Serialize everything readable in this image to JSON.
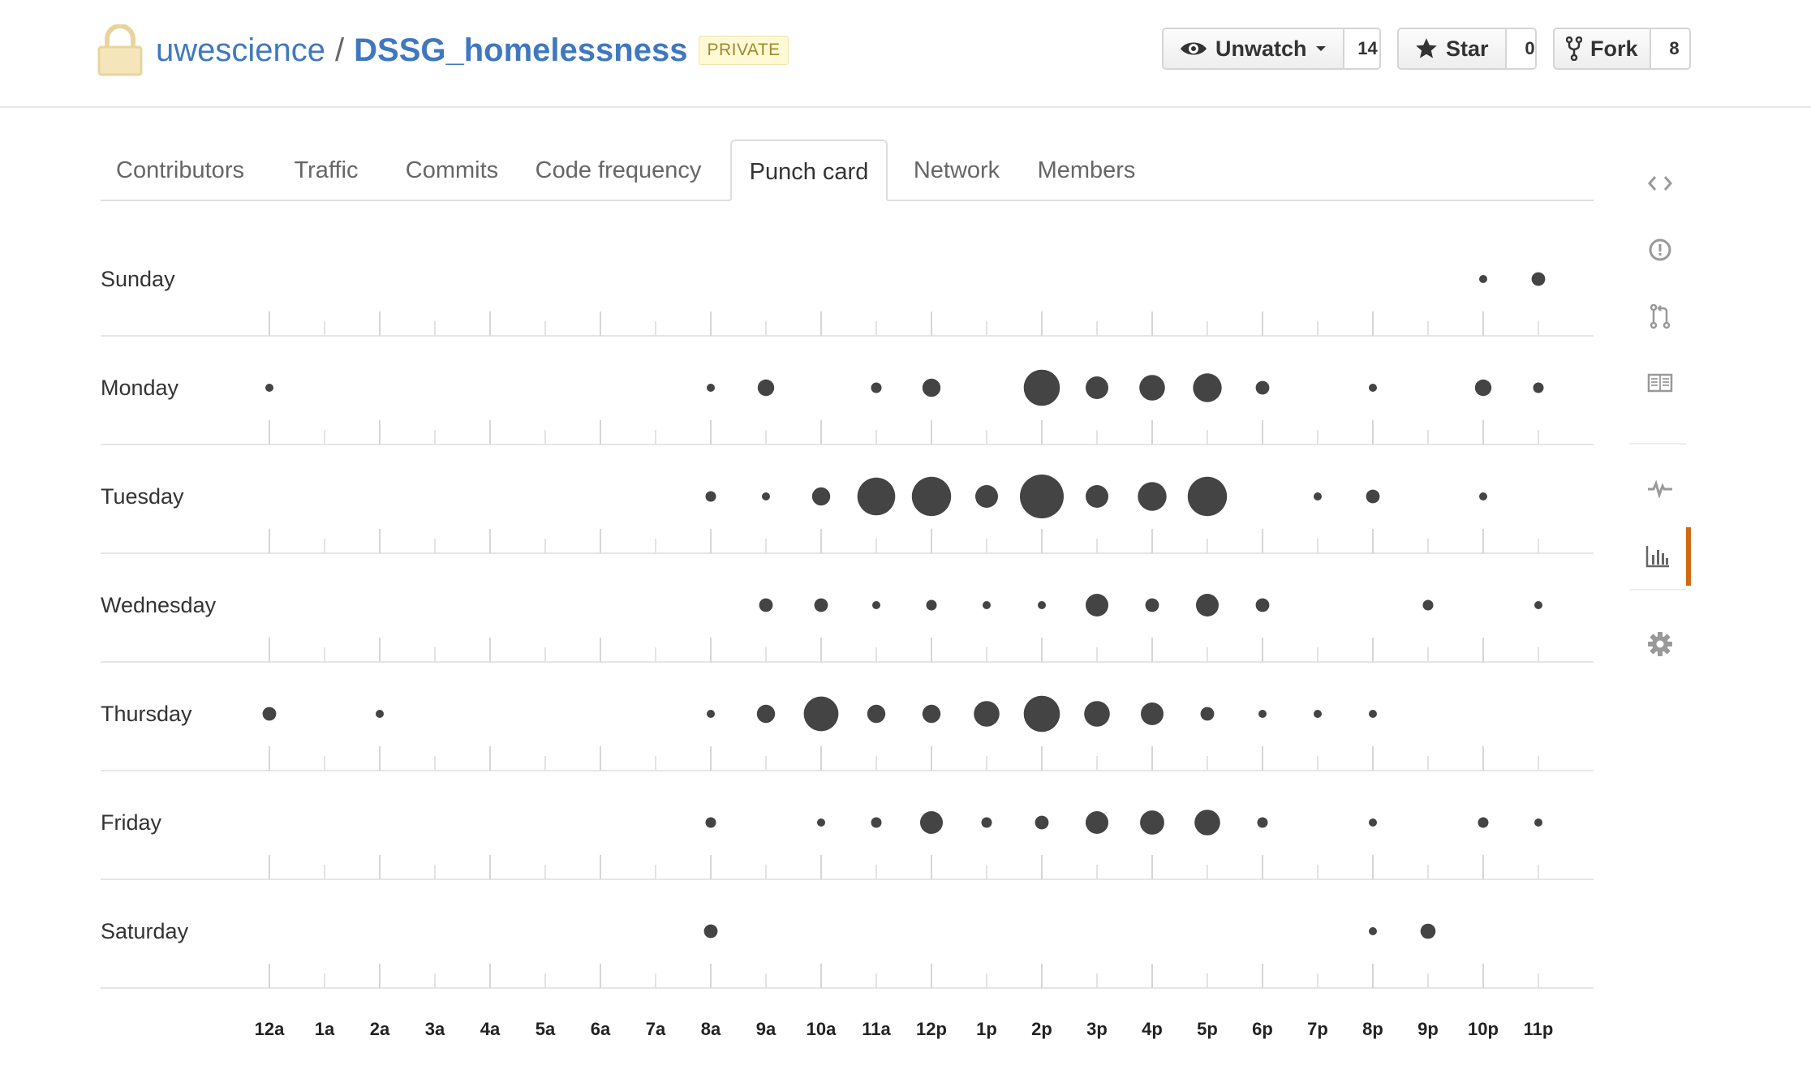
{
  "repo": {
    "owner": "uwescience",
    "separator": "/",
    "name": "DSSG_homelessness",
    "badge": "PRIVATE"
  },
  "actions": {
    "watch": {
      "label": "Unwatch",
      "count": "14"
    },
    "star": {
      "label": "Star",
      "count": "0"
    },
    "fork": {
      "label": "Fork",
      "count": "8"
    }
  },
  "tabs": [
    {
      "label": "Contributors",
      "selected": false
    },
    {
      "label": "Traffic",
      "selected": false
    },
    {
      "label": "Commits",
      "selected": false
    },
    {
      "label": "Code frequency",
      "selected": false
    },
    {
      "label": "Punch card",
      "selected": true
    },
    {
      "label": "Network",
      "selected": false
    },
    {
      "label": "Members",
      "selected": false
    }
  ],
  "sidebar": {
    "items": [
      {
        "icon": "code-icon"
      },
      {
        "icon": "issues-icon"
      },
      {
        "icon": "pull-request-icon"
      },
      {
        "icon": "wiki-icon"
      },
      {
        "icon": "pulse-icon"
      },
      {
        "icon": "graphs-icon",
        "active": true
      },
      {
        "icon": "settings-icon"
      }
    ],
    "accent": "#d26911"
  },
  "colors": {
    "link": "#4078c0",
    "dot": "#444444",
    "rule": "#e5e5e5"
  },
  "chart_data": {
    "type": "scatter",
    "days": [
      "Sunday",
      "Monday",
      "Tuesday",
      "Wednesday",
      "Thursday",
      "Friday",
      "Saturday"
    ],
    "hours": [
      "12a",
      "1a",
      "2a",
      "3a",
      "4a",
      "5a",
      "6a",
      "7a",
      "8a",
      "9a",
      "10a",
      "11a",
      "12p",
      "1p",
      "2p",
      "3p",
      "4p",
      "5p",
      "6p",
      "7p",
      "8p",
      "9p",
      "10p",
      "11p"
    ],
    "max_size": 29,
    "values": [
      [
        0,
        0,
        0,
        0,
        0,
        0,
        0,
        0,
        0,
        0,
        0,
        0,
        0,
        0,
        0,
        0,
        0,
        0,
        0,
        0,
        0,
        0,
        5,
        9
      ],
      [
        5,
        0,
        0,
        0,
        0,
        0,
        0,
        0,
        5,
        11,
        0,
        7,
        12,
        0,
        24,
        15,
        17,
        19,
        9,
        0,
        5,
        0,
        11,
        7
      ],
      [
        0,
        0,
        0,
        0,
        0,
        0,
        0,
        0,
        7,
        5,
        12,
        25,
        26,
        15,
        29,
        15,
        19,
        26,
        0,
        4,
        9,
        0,
        4,
        0
      ],
      [
        0,
        0,
        0,
        0,
        0,
        0,
        0,
        0,
        0,
        9,
        9,
        3,
        7,
        5,
        3,
        15,
        9,
        15,
        9,
        0,
        0,
        7,
        0,
        3
      ],
      [
        9,
        0,
        4,
        0,
        0,
        0,
        0,
        0,
        5,
        12,
        23,
        12,
        12,
        17,
        24,
        17,
        15,
        9,
        5,
        5,
        3,
        0,
        0,
        0
      ],
      [
        0,
        0,
        0,
        0,
        0,
        0,
        0,
        0,
        7,
        0,
        3,
        7,
        15,
        7,
        9,
        15,
        16,
        17,
        7,
        0,
        3,
        0,
        7,
        3
      ],
      [
        0,
        0,
        0,
        0,
        0,
        0,
        0,
        0,
        9,
        0,
        0,
        0,
        0,
        0,
        0,
        0,
        0,
        0,
        0,
        0,
        5,
        10,
        0,
        0
      ]
    ]
  }
}
